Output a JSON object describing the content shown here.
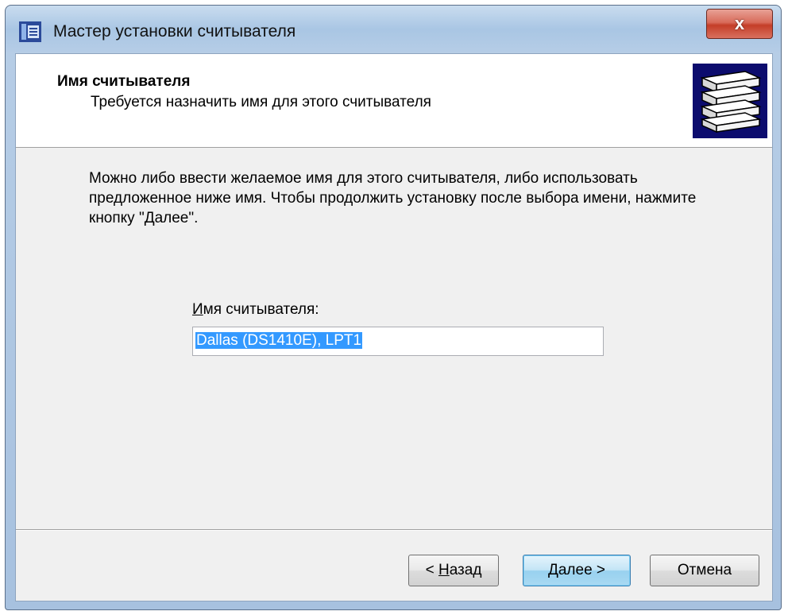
{
  "window": {
    "title": "Мастер установки считывателя",
    "close_label": "x",
    "accent_color": "#c43e28"
  },
  "header": {
    "title": "Имя считывателя",
    "subtitle": "Требуется назначить имя для этого считывателя",
    "image_icon": "reader-stack-icon"
  },
  "main": {
    "description": "Можно либо ввести желаемое имя для этого считывателя, либо использовать предложенное ниже имя. Чтобы продолжить установку после выбора имени, нажмите кнопку \"Далее\".",
    "field_label_accel": "И",
    "field_label_rest": "мя считывателя:",
    "reader_name_value": "Dallas (DS1410E), LPT1"
  },
  "footer": {
    "back_prefix": "< ",
    "back_accel": "Н",
    "back_rest": "азад",
    "next_accel": "Д",
    "next_rest": "алее >",
    "cancel_label": "Отмена"
  }
}
